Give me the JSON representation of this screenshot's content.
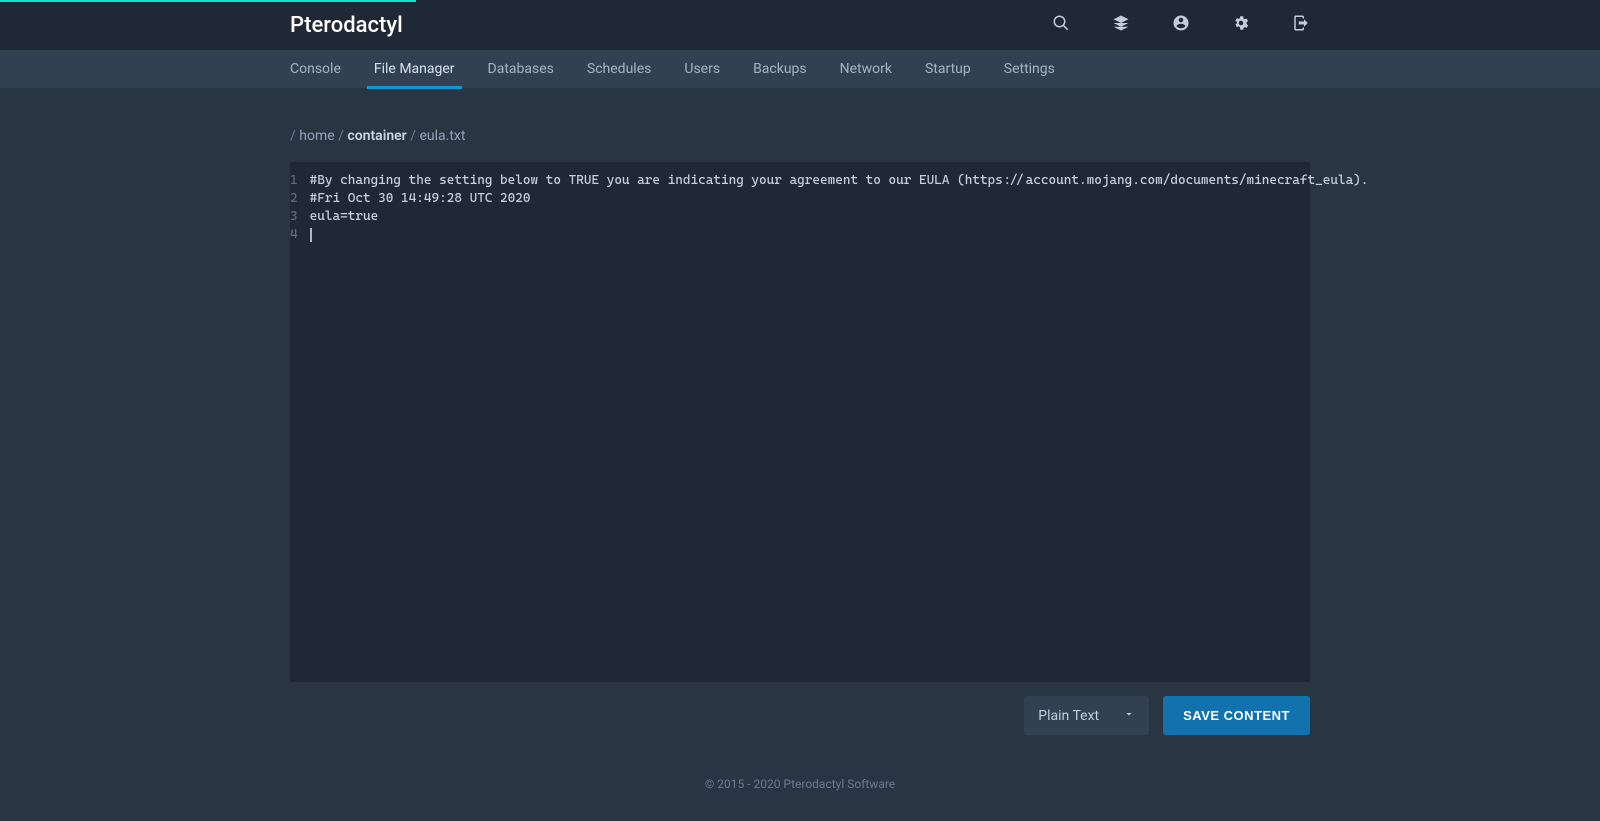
{
  "brand": "Pterodactyl",
  "subnav": {
    "items": [
      {
        "label": "Console"
      },
      {
        "label": "File Manager"
      },
      {
        "label": "Databases"
      },
      {
        "label": "Schedules"
      },
      {
        "label": "Users"
      },
      {
        "label": "Backups"
      },
      {
        "label": "Network"
      },
      {
        "label": "Startup"
      },
      {
        "label": "Settings"
      }
    ]
  },
  "breadcrumb": {
    "sep": "/",
    "home": "home",
    "container": "container",
    "file": "eula.txt"
  },
  "editor": {
    "lines": [
      "#By changing the setting below to TRUE you are indicating your agreement to our EULA (https://account.mojang.com/documents/minecraft_eula).",
      "#Fri Oct 30 14:49:28 UTC 2020",
      "eula=true",
      ""
    ],
    "line_numbers": [
      "1",
      "2",
      "3",
      "4"
    ]
  },
  "actions": {
    "format_label": "Plain Text",
    "save_label": "SAVE CONTENT"
  },
  "footer": "© 2015 - 2020 Pterodactyl Software"
}
